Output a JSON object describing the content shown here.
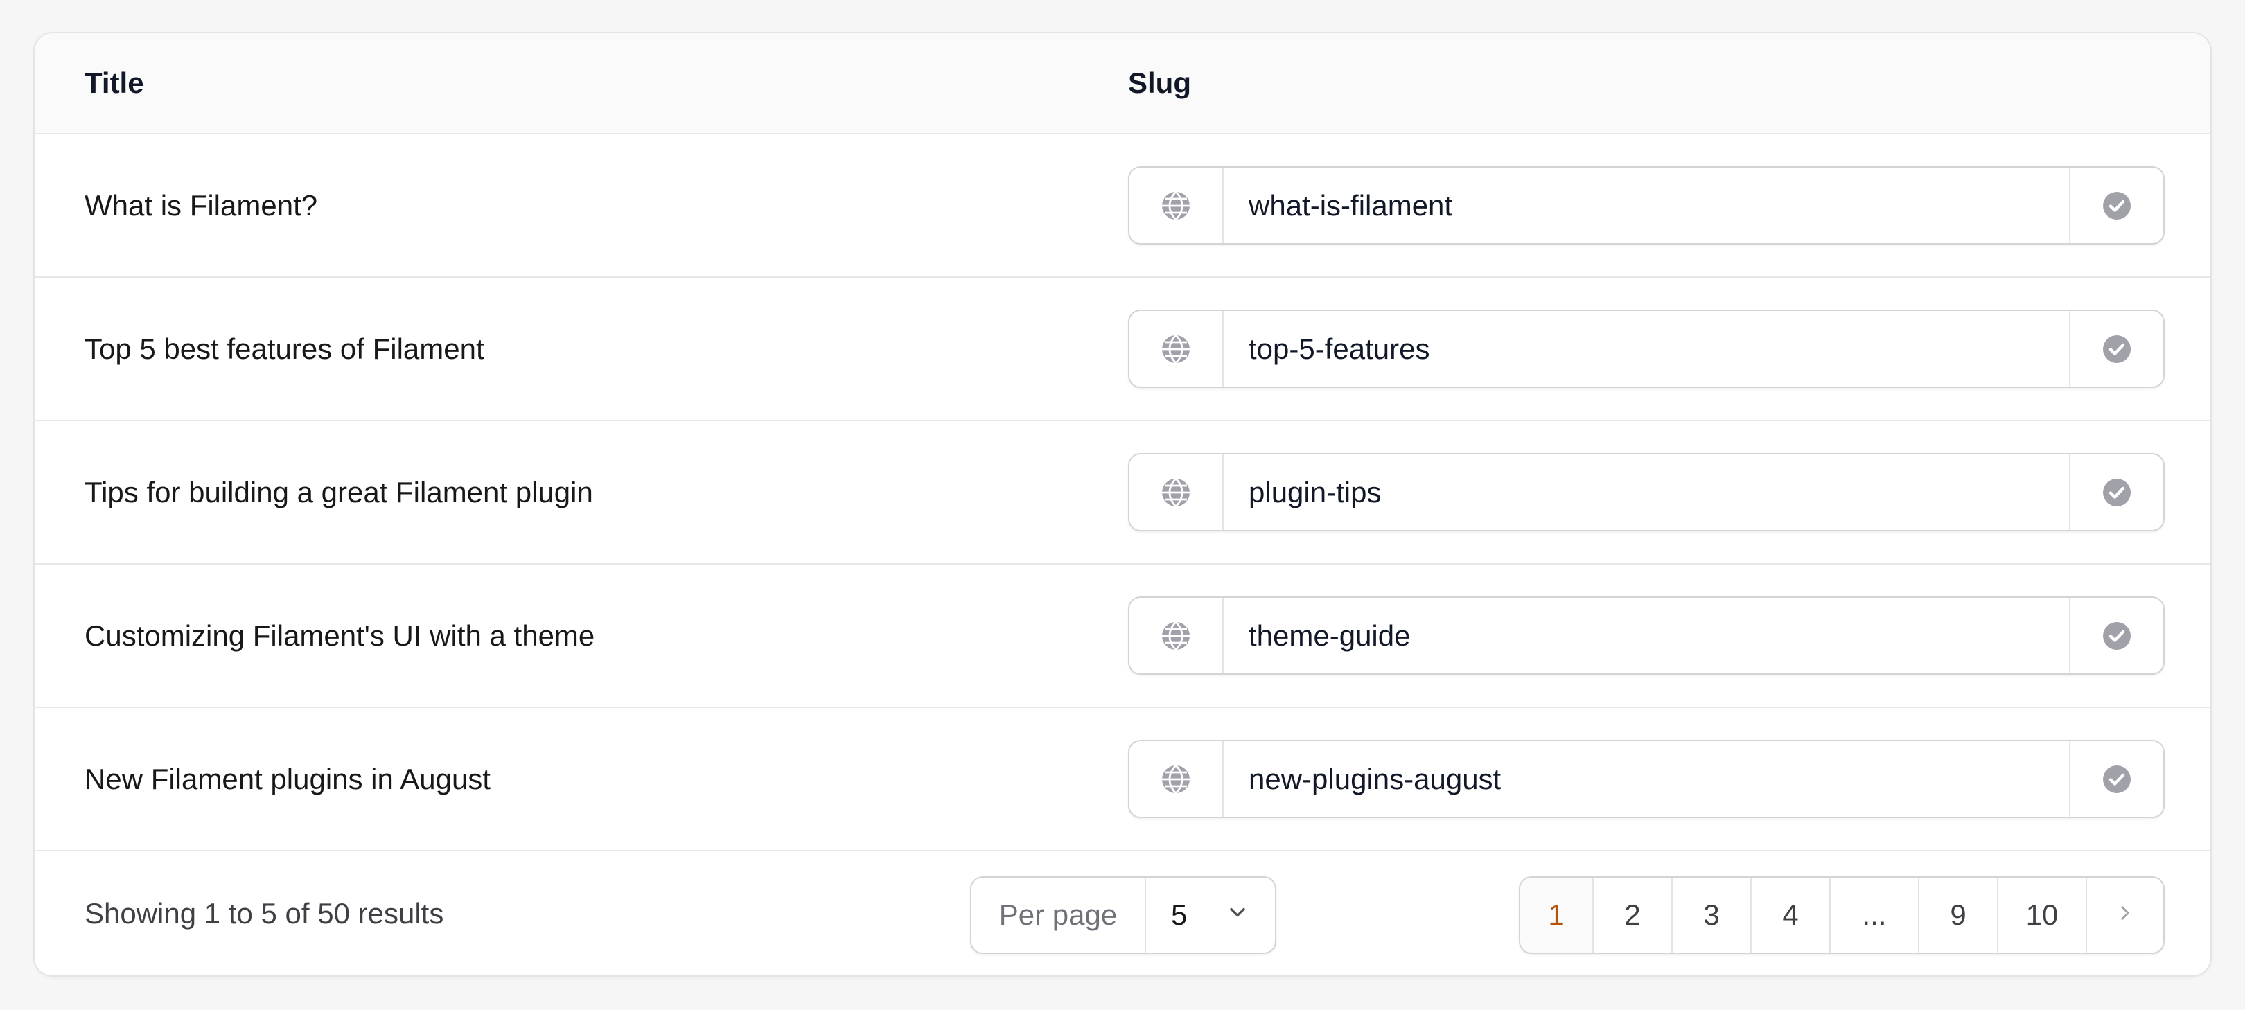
{
  "columns": {
    "title": "Title",
    "slug": "Slug"
  },
  "rows": [
    {
      "title": "What is Filament?",
      "slug": "what-is-filament"
    },
    {
      "title": "Top 5 best features of Filament",
      "slug": "top-5-features"
    },
    {
      "title": "Tips for building a great Filament plugin",
      "slug": "plugin-tips"
    },
    {
      "title": "Customizing Filament's UI with a theme",
      "slug": "theme-guide"
    },
    {
      "title": "New Filament plugins in August",
      "slug": "new-plugins-august"
    }
  ],
  "footer": {
    "showing": "Showing 1 to 5 of 50 results",
    "per_page_label": "Per page",
    "per_page_value": "5",
    "pages": [
      "1",
      "2",
      "3",
      "4",
      "...",
      "9",
      "10"
    ],
    "active_page": "1"
  },
  "icons": {
    "prefix": "globe-icon",
    "suffix": "check-circle-icon",
    "select": "chevron-down-icon",
    "next": "chevron-right-icon"
  },
  "colors": {
    "icon": "#a1a1aa",
    "active_page": "#b45309",
    "border": "#e5e7eb"
  }
}
